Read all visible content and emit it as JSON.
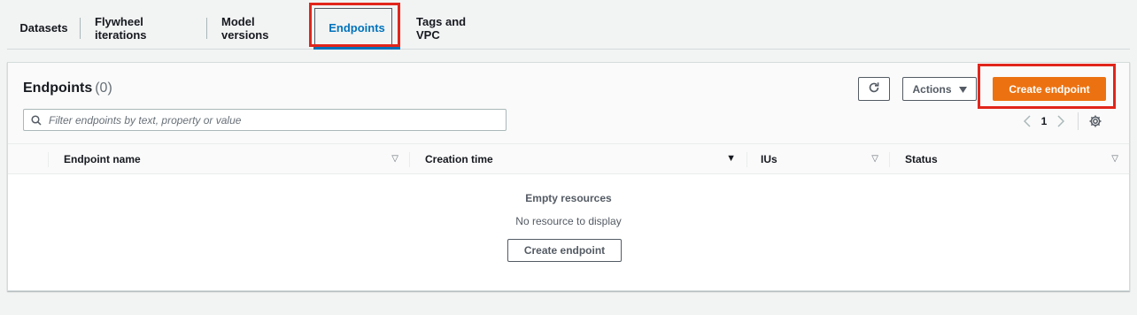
{
  "tabs": [
    {
      "label": "Datasets",
      "active": false
    },
    {
      "label": "Flywheel iterations",
      "active": false
    },
    {
      "label": "Model versions",
      "active": false
    },
    {
      "label": "Endpoints",
      "active": true
    },
    {
      "label": "Tags and VPC",
      "active": false
    }
  ],
  "panel": {
    "title": "Endpoints",
    "count": "(0)",
    "search_placeholder": "Filter endpoints by text, property or value",
    "actions_label": "Actions",
    "create_label": "Create endpoint",
    "refresh_icon": "refresh-icon"
  },
  "pagination": {
    "current_page": "1",
    "prev_icon": "chevron-left-icon",
    "next_icon": "chevron-right-icon",
    "settings_icon": "gear-icon"
  },
  "table": {
    "columns": [
      {
        "label": "Endpoint name",
        "sort": "none"
      },
      {
        "label": "Creation time",
        "sort": "descending"
      },
      {
        "label": "IUs",
        "sort": "none"
      },
      {
        "label": "Status",
        "sort": "none"
      }
    ],
    "rows": []
  },
  "empty_state": {
    "title": "Empty resources",
    "text": "No resource to display",
    "button_label": "Create endpoint"
  },
  "colors": {
    "primary": "#ec7211",
    "active_tab": "#0073bb",
    "highlight": "#e1251b"
  }
}
